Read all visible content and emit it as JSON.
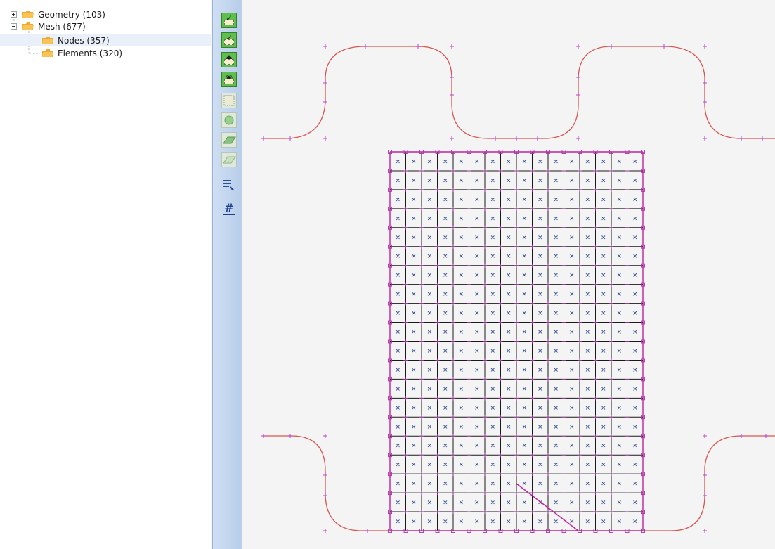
{
  "tree": {
    "items": [
      {
        "label": "Geometry (103)"
      },
      {
        "label": "Mesh (677)"
      },
      {
        "label": "Nodes (357)"
      },
      {
        "label": "Elements (320)"
      }
    ]
  },
  "toolbar": {
    "buttons": [
      {
        "icon": "check-mesh-icon"
      },
      {
        "icon": "check-elements-icon"
      },
      {
        "icon": "show-nodes-icon"
      },
      {
        "icon": "view-mesh-icon"
      },
      {
        "icon": "grid-icon"
      },
      {
        "icon": "surface-icon"
      },
      {
        "icon": "plane-icon"
      },
      {
        "icon": "plane-light-icon"
      },
      {
        "icon": "select-list-icon"
      },
      {
        "icon": "numbering-icon",
        "glyph": "#"
      }
    ]
  },
  "colors": {
    "geometry_curve": "#d9534f",
    "mesh_boundary": "#c0259a",
    "node_marker": "#b030b0",
    "element_line": "#1a1a1a",
    "element_cross": "#1f3a8a"
  }
}
